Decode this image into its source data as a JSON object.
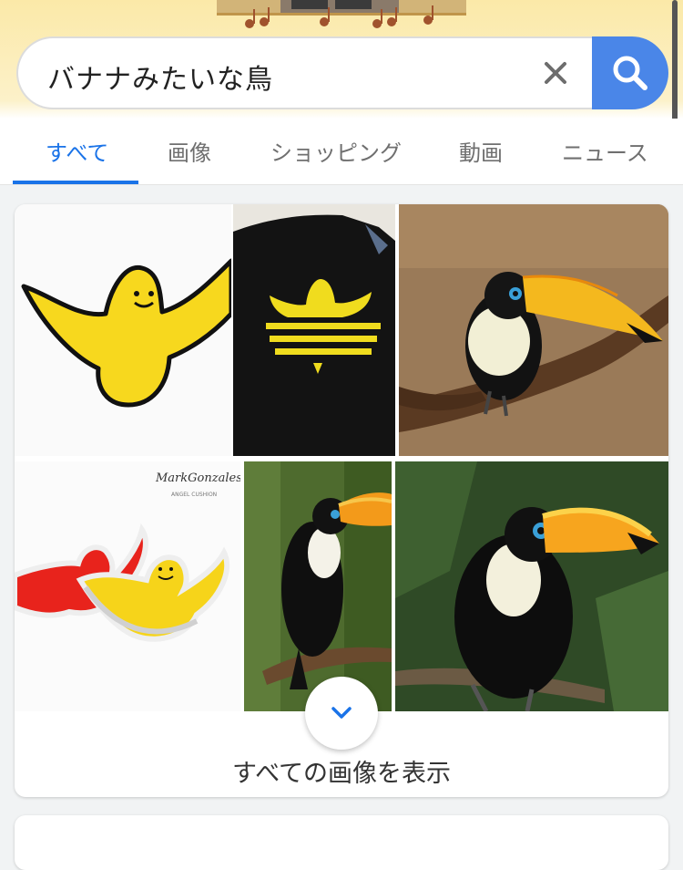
{
  "search": {
    "query": "バナナみたいな鳥"
  },
  "tabs": [
    {
      "label": "すべて",
      "active": true
    },
    {
      "label": "画像",
      "active": false
    },
    {
      "label": "ショッピング",
      "active": false
    },
    {
      "label": "動画",
      "active": false
    },
    {
      "label": "ニュース",
      "active": false
    }
  ],
  "images": {
    "show_all_label": "すべての画像を表示",
    "thumbnails": [
      "yellow-bird-drawing",
      "black-shirt-bird-logo",
      "toucan-on-branch",
      "red-and-yellow-bird-cushions",
      "toucan-in-forest",
      "toucan-closeup"
    ]
  },
  "icons": {
    "clear": "close-icon",
    "search": "search-icon",
    "expand": "chevron-down-icon"
  },
  "colors": {
    "accent": "#1a73e8",
    "search_button": "#4a86e8",
    "header_bg": "#fbe9a8"
  }
}
